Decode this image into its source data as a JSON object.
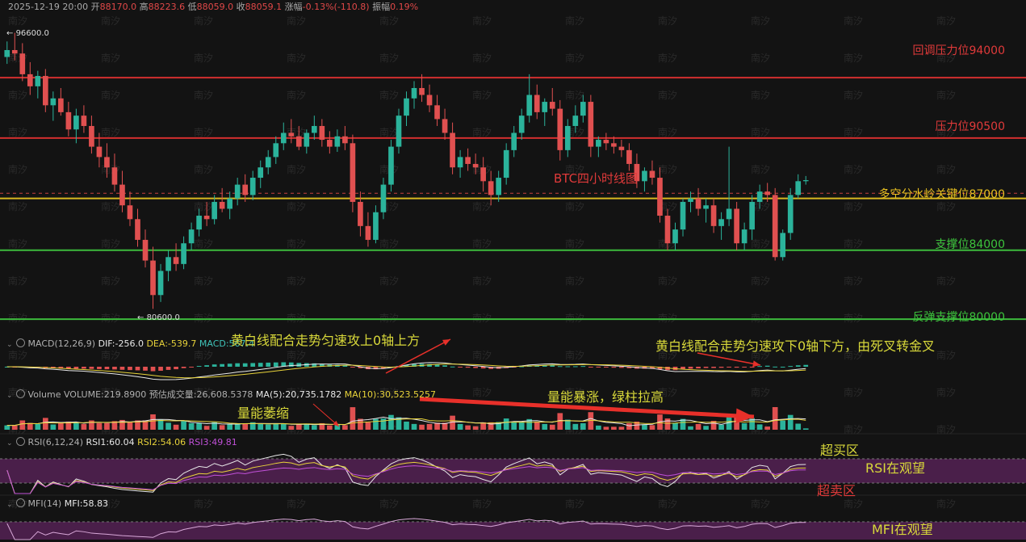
{
  "header": {
    "datetime": "2025-12-19 20:00",
    "open_label": "开",
    "open": "88170.0",
    "high_label": "高",
    "high": "88223.6",
    "low_label": "低",
    "low": "88059.0",
    "close_label": "收",
    "close": "88059.1",
    "change_label": "涨幅",
    "change": "-0.13%(-110.8)",
    "amp_label": "振幅",
    "amp": "0.19%"
  },
  "price_marks": {
    "high_mark": "96600.0",
    "low_mark": "80600.0"
  },
  "levels": [
    {
      "label": "回调压力位94000",
      "value": 94000,
      "color": "#e03a3a",
      "line": "#d32f2f"
    },
    {
      "label": "压力位90500",
      "value": 90500,
      "color": "#e03a3a",
      "line": "#d32f2f"
    },
    {
      "label": "多空分水岭关键位87000",
      "value": 87000,
      "color": "#e8c020",
      "line": "#d8b820",
      "dashed_ref": 87300
    },
    {
      "label": "支撑位84000",
      "value": 84000,
      "color": "#3cc43c",
      "line": "#3cba3c"
    },
    {
      "label": "反弹支撑位80000",
      "value": 80000,
      "color": "#3cc43c",
      "line": "#3cba3c"
    }
  ],
  "title": "BTC四小时线图",
  "macd": {
    "label": "MACD(12,26,9)",
    "dif": "DIF:-256.0",
    "dea": "DEA:-539.7",
    "macd": "MACD:567.4"
  },
  "volume": {
    "label": "Volume",
    "vol": "VOLUME:219.8900",
    "est": "预估成交量:26,608.5378",
    "ma5": "MA(5):20,735.1782",
    "ma10": "MA(10):30,523.5257"
  },
  "rsi": {
    "label": "RSI(6,12,24)",
    "rsi1": "RSI1:60.04",
    "rsi2": "RSI2:54.06",
    "rsi3": "RSI3:49.81"
  },
  "mfi": {
    "label": "MFI(14)",
    "mfi": "MFI:58.83"
  },
  "annotations": {
    "macd_left": "黄白线配合走势匀速攻上0轴上方",
    "macd_right": "黄白线配合走势匀速攻下0轴下方，由死叉转金叉",
    "vol_left": "量能萎缩",
    "vol_right": "量能暴涨，绿柱拉高",
    "overbought": "超买区",
    "rsi_watch": "RSI在观望",
    "oversold": "超卖区",
    "mfi_watch": "MFI在观望"
  },
  "watermark": "南汐",
  "colors": {
    "up": "#2bb39b",
    "down": "#e05050",
    "bg": "#131313"
  },
  "chart_data": {
    "type": "candlestick",
    "timeframe": "4h",
    "y_range": [
      79400,
      97800
    ],
    "ohlc": [
      [
        95200,
        96100,
        94800,
        95600
      ],
      [
        95600,
        96600,
        95000,
        95400
      ],
      [
        95400,
        96000,
        93800,
        94200
      ],
      [
        94200,
        94900,
        93000,
        93500
      ],
      [
        93500,
        94400,
        92800,
        94100
      ],
      [
        94100,
        94500,
        92000,
        92400
      ],
      [
        92400,
        93200,
        91500,
        92800
      ],
      [
        92800,
        93400,
        91800,
        92000
      ],
      [
        92000,
        92600,
        90600,
        91000
      ],
      [
        91000,
        92200,
        90200,
        91800
      ],
      [
        91800,
        92400,
        90800,
        91200
      ],
      [
        91200,
        91800,
        89600,
        90000
      ],
      [
        90000,
        90800,
        88800,
        89400
      ],
      [
        89400,
        90200,
        88200,
        88800
      ],
      [
        88800,
        89600,
        87400,
        87800
      ],
      [
        87800,
        88600,
        86200,
        86600
      ],
      [
        86600,
        87400,
        85400,
        85800
      ],
      [
        85800,
        86400,
        84200,
        84600
      ],
      [
        84600,
        85200,
        83000,
        83400
      ],
      [
        83400,
        84200,
        80600,
        81400
      ],
      [
        81400,
        83200,
        81000,
        82800
      ],
      [
        82800,
        84000,
        82200,
        83600
      ],
      [
        83600,
        84400,
        82800,
        83200
      ],
      [
        83200,
        84800,
        82900,
        84400
      ],
      [
        84400,
        85600,
        84000,
        85200
      ],
      [
        85200,
        86400,
        84800,
        86000
      ],
      [
        86000,
        86800,
        85400,
        85800
      ],
      [
        85800,
        87200,
        85500,
        86800
      ],
      [
        86800,
        87600,
        86200,
        86400
      ],
      [
        86400,
        87400,
        85800,
        87000
      ],
      [
        87000,
        88200,
        86600,
        87800
      ],
      [
        87800,
        88400,
        86800,
        87200
      ],
      [
        87200,
        88600,
        86900,
        88200
      ],
      [
        88200,
        89200,
        87600,
        88800
      ],
      [
        88800,
        89800,
        88400,
        89400
      ],
      [
        89400,
        90600,
        89000,
        90200
      ],
      [
        90200,
        91400,
        89800,
        90800
      ],
      [
        90800,
        91600,
        90200,
        90600
      ],
      [
        90600,
        91200,
        89800,
        90000
      ],
      [
        90000,
        91000,
        89600,
        90800
      ],
      [
        90800,
        91800,
        90400,
        91200
      ],
      [
        91200,
        91600,
        90000,
        90400
      ],
      [
        90400,
        90900,
        89600,
        90000
      ],
      [
        90000,
        91000,
        89700,
        90600
      ],
      [
        90600,
        91200,
        89800,
        90200
      ],
      [
        90200,
        90700,
        86200,
        86800
      ],
      [
        86800,
        87400,
        84800,
        85400
      ],
      [
        85400,
        86200,
        84200,
        84600
      ],
      [
        84600,
        86600,
        84400,
        86200
      ],
      [
        86200,
        88200,
        85800,
        87800
      ],
      [
        87800,
        90400,
        87400,
        90000
      ],
      [
        90000,
        92200,
        89600,
        91800
      ],
      [
        91800,
        93200,
        91200,
        92800
      ],
      [
        92800,
        93800,
        92200,
        93400
      ],
      [
        93400,
        94200,
        92600,
        93000
      ],
      [
        93000,
        93600,
        92000,
        92400
      ],
      [
        92400,
        93000,
        91200,
        91600
      ],
      [
        91600,
        92200,
        90400,
        90800
      ],
      [
        90800,
        91400,
        88400,
        88800
      ],
      [
        88800,
        89800,
        88200,
        89400
      ],
      [
        89400,
        89900,
        88600,
        89000
      ],
      [
        89000,
        89600,
        88400,
        88800
      ],
      [
        88800,
        89400,
        87400,
        88000
      ],
      [
        88000,
        88600,
        86600,
        87200
      ],
      [
        87200,
        88600,
        86800,
        88200
      ],
      [
        88200,
        90200,
        87800,
        89800
      ],
      [
        89800,
        91200,
        89400,
        90800
      ],
      [
        90800,
        92200,
        90400,
        91800
      ],
      [
        91800,
        94200,
        91400,
        93000
      ],
      [
        93000,
        93600,
        91600,
        92000
      ],
      [
        92000,
        92800,
        91200,
        92600
      ],
      [
        92600,
        93400,
        91800,
        92200
      ],
      [
        92200,
        92700,
        89200,
        89800
      ],
      [
        89800,
        91600,
        89400,
        91200
      ],
      [
        91200,
        92400,
        90800,
        91800
      ],
      [
        91800,
        93000,
        91400,
        92600
      ],
      [
        92600,
        93000,
        89400,
        90000
      ],
      [
        90000,
        90600,
        89400,
        90400
      ],
      [
        90400,
        90800,
        89800,
        90200
      ],
      [
        90200,
        90600,
        89600,
        90000
      ],
      [
        90000,
        90400,
        89400,
        89800
      ],
      [
        89800,
        90200,
        88600,
        89000
      ],
      [
        89000,
        89600,
        87600,
        88000
      ],
      [
        88000,
        88800,
        87400,
        88600
      ],
      [
        88600,
        89200,
        87800,
        88200
      ],
      [
        88200,
        88800,
        85600,
        86000
      ],
      [
        86000,
        86400,
        84000,
        84400
      ],
      [
        84400,
        85600,
        84000,
        85200
      ],
      [
        85200,
        87000,
        84800,
        86800
      ],
      [
        86800,
        87400,
        86200,
        87000
      ],
      [
        87000,
        87600,
        86000,
        86400
      ],
      [
        86400,
        87000,
        85600,
        86600
      ],
      [
        86600,
        87000,
        85000,
        85400
      ],
      [
        85400,
        86200,
        84600,
        85800
      ],
      [
        85800,
        90000,
        85400,
        86400
      ],
      [
        86400,
        86800,
        84000,
        84400
      ],
      [
        84400,
        85600,
        84000,
        85200
      ],
      [
        85200,
        87200,
        84600,
        86800
      ],
      [
        86800,
        87800,
        86400,
        87400
      ],
      [
        87400,
        87900,
        86800,
        87200
      ],
      [
        87200,
        87600,
        83400,
        83600
      ],
      [
        83600,
        85200,
        83400,
        85000
      ],
      [
        85000,
        87600,
        84600,
        87200
      ],
      [
        87200,
        88400,
        87000,
        88000
      ],
      [
        88000,
        88300,
        87800,
        88059
      ]
    ]
  }
}
